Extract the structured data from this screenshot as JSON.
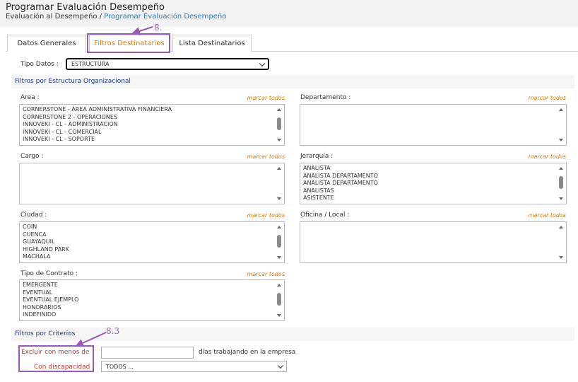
{
  "page": {
    "title": "Programar Evaluación Desempeño",
    "breadcrumb_root": "Evaluación al Desempeño",
    "breadcrumb_sep": "/",
    "breadcrumb_current": "Programar Evaluación Desempeño"
  },
  "tabs": [
    {
      "label": "Datos Generales"
    },
    {
      "label": "Filtros Destinatarios",
      "active": true
    },
    {
      "label": "Lista Destinatarios"
    }
  ],
  "tipo_datos": {
    "label": "Tipo Datos :",
    "value": "ESTRUCTURA"
  },
  "section_estructura": {
    "title": "Filtros por Estructura Organizacional"
  },
  "mark_all_label": "marcar todos",
  "fields": {
    "area": {
      "label": "Area :",
      "options": [
        "CORNERSTONE - ÁREA ADMINISTRATIVA FINANCIERA",
        "CORNERSTONE 2 - OPERACIONES",
        "INNOVEKI - CL - ADMINISTRACION",
        "INNOVEKI - CL - COMERCIAL",
        "INNOVEKI - CL - SOPORTE"
      ]
    },
    "departamento": {
      "label": "Departamento :",
      "options": []
    },
    "cargo": {
      "label": "Cargo :",
      "options": []
    },
    "jerarquia": {
      "label": "Jerarquía :",
      "options": [
        "ANALISTA",
        "ANALISTA DEPARTAMENTO",
        "ANALISTA DEPARTAMENTO",
        "ANALISTAS",
        "ASISTENTE"
      ]
    },
    "ciudad": {
      "label": "Ciudad :",
      "options": [
        "COIN",
        "CUENCA",
        "GUAYAQUIL",
        "HIGHLAND PARK",
        "MACHALA"
      ]
    },
    "oficina": {
      "label": "Oficina / Local :",
      "options": []
    },
    "tipo_contrato": {
      "label": "Tipo de Contrato :",
      "options": [
        "EMERGENTE",
        "EVENTUAL",
        "EVENTUAL EJEMPLO",
        "HONORARIOS",
        "INDEFINIDO"
      ]
    }
  },
  "section_criterios": {
    "title": "Filtros por Criterios"
  },
  "criterios": {
    "excluir_label": "Excluir con menos de",
    "excluir_value": "",
    "dias_text": "días trabajando en la empresa",
    "discapacidad_label": "Con discapacidad",
    "discapacidad_value": "TODOS ..."
  },
  "annotations": {
    "tab_step": "8.",
    "criteria_step": "8.3"
  },
  "colors": {
    "accent": "#e07b00",
    "annotation": "#9b59b6",
    "section_title": "#1a3a9a",
    "link": "#2a7ab0",
    "criteria_label": "#c0392b"
  }
}
